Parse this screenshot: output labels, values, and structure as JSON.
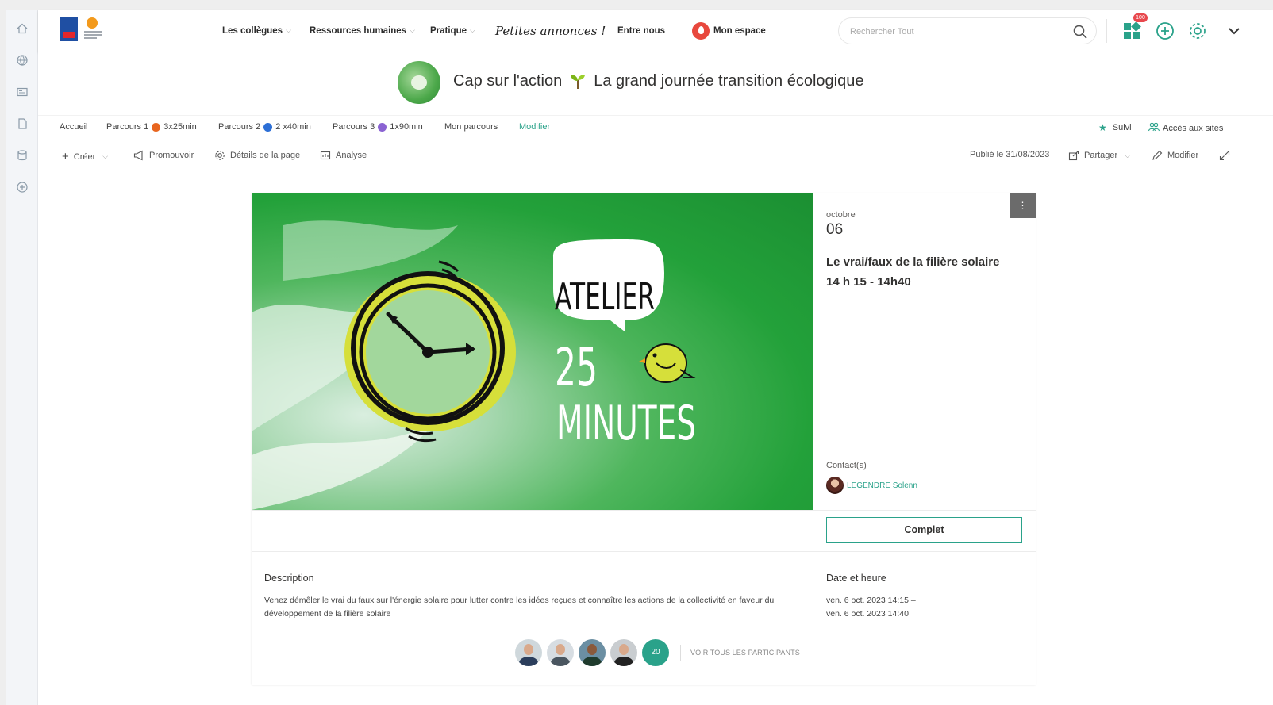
{
  "topbar": {
    "nav": [
      {
        "label": "Les collègues",
        "has_dropdown": true
      },
      {
        "label": "Ressources humaines",
        "has_dropdown": true
      },
      {
        "label": "Pratique",
        "has_dropdown": true
      },
      {
        "label": "Petites annonces !",
        "has_dropdown": false
      },
      {
        "label": "Entre nous",
        "has_dropdown": false
      },
      {
        "label": "Mon espace",
        "has_dropdown": false
      }
    ],
    "search_placeholder": "Rechercher Tout",
    "apps_badge": "100"
  },
  "banner": {
    "title_part1": "Cap sur l'action",
    "title_part2": "La grand journée transition écologique"
  },
  "page_nav": {
    "items": [
      {
        "label": "Accueil"
      },
      {
        "label": "Parcours 1",
        "suffix": "3x25min",
        "dot_color": "#e8651f"
      },
      {
        "label": "Parcours 2",
        "suffix": "2 x40min",
        "dot_color": "#2c6fd6"
      },
      {
        "label": "Parcours 3",
        "suffix": "1x90min",
        "dot_color": "#8a63d2"
      },
      {
        "label": "Mon parcours"
      },
      {
        "label": "Modifier"
      }
    ],
    "suivi": "Suivi",
    "acces": "Accès aux sites"
  },
  "command_bar": {
    "create": "Créer",
    "promote": "Promouvoir",
    "details": "Détails de la page",
    "analytics": "Analyse",
    "published": "Publié le 31/08/2023",
    "share": "Partager",
    "edit": "Modifier"
  },
  "event": {
    "hero_text": {
      "line1": "ATELIER",
      "line2": "25",
      "line3": "MINUTES"
    },
    "month": "octobre",
    "day": "06",
    "title": "Le vrai/faux de la filière solaire",
    "time": "14 h 15 - 14h40",
    "contacts_label": "Contact(s)",
    "contact_name": "LEGENDRE Solenn",
    "status_button": "Complet",
    "description_label": "Description",
    "description": "Venez démêler le vrai du faux sur l'énergie solaire pour lutter contre les idées reçues et connaître les actions de la collectivité en faveur du développement de la filière solaire",
    "datetime_label": "Date et heure",
    "datetime_start": "ven. 6 oct. 2023 14:15 –",
    "datetime_end": "ven. 6 oct. 2023 14:40",
    "participants_count": "20",
    "see_all": "VOIR TOUS LES PARTICIPANTS"
  },
  "colors": {
    "accent": "#2aa28a",
    "hero_green": "#23a13a",
    "clock_ring": "#d6df3a"
  }
}
